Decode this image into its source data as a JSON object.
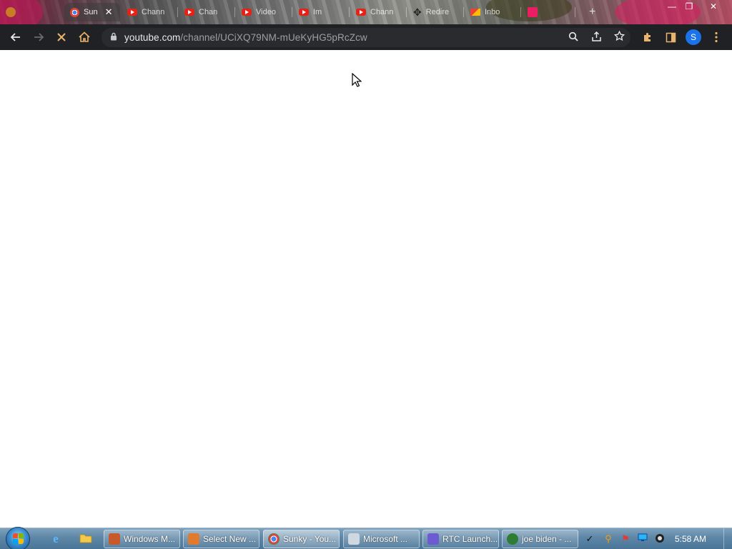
{
  "browser": {
    "tabs": [
      {
        "label": "Sun",
        "favicon": "chrome-icon",
        "active": true
      },
      {
        "label": "Chann",
        "favicon": "youtube-icon"
      },
      {
        "label": "Chan",
        "favicon": "youtube-icon"
      },
      {
        "label": "Video",
        "favicon": "youtube-icon"
      },
      {
        "label": "Im",
        "favicon": "youtube-icon"
      },
      {
        "label": "Chann",
        "favicon": "youtube-icon"
      },
      {
        "label": "Redire",
        "favicon": "move-icon"
      },
      {
        "label": "Inbo",
        "favicon": "gmail-icon"
      },
      {
        "label": "",
        "favicon": "download-icon"
      }
    ],
    "tab_close": "✕",
    "new_tab": "+",
    "window_controls": {
      "minimize": "—",
      "restore": "❐",
      "close": "✕"
    },
    "address": {
      "host": "youtube.com",
      "path": "/channel/UCiXQ79NM-mUeKyHG5pRcZcw"
    },
    "profile_initial": "S"
  },
  "taskbar": {
    "tasks": [
      {
        "label": "Windows M...",
        "icon_color": "#c75a2a"
      },
      {
        "label": "Select New ...",
        "icon_color": "#e07a2e"
      },
      {
        "label": "Sunky - You...",
        "icon_color": "#4285f4",
        "active": true
      },
      {
        "label": "Microsoft ...",
        "icon_color": "#cfd8e0"
      },
      {
        "label": "RTC Launch...",
        "icon_color": "#6c5bd1"
      },
      {
        "label": "joe biden - ...",
        "icon_color": "#2e7d32"
      }
    ],
    "clock": "5:58 AM"
  },
  "colors": {
    "toolbar_bg": "#202124",
    "omnibox_bg": "#2a2b2e",
    "youtube_red": "#e62117",
    "avatar_blue": "#1a73e8"
  }
}
